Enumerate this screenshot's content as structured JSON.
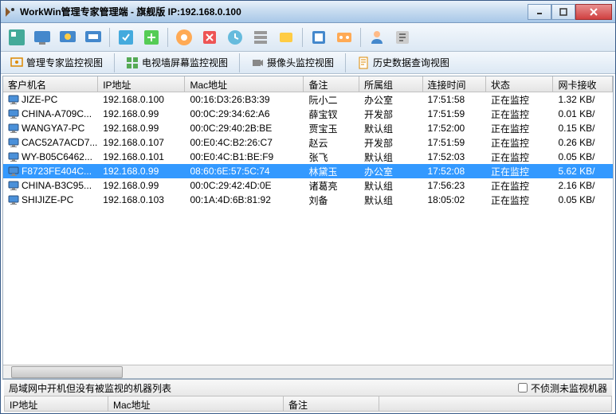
{
  "window": {
    "title": "WorkWin管理专家管理端 - 旗舰版 IP:192.168.0.100"
  },
  "tabs": {
    "expert": "管理专家监控视图",
    "tvwall": "电视墙屏幕监控视图",
    "camera": "摄像头监控视图",
    "history": "历史数据查询视图"
  },
  "table": {
    "headers": [
      "客户机名",
      "IP地址",
      "Mac地址",
      "备注",
      "所属组",
      "连接时间",
      "状态",
      "网卡接收"
    ],
    "rows": [
      {
        "name": "JIZE-PC",
        "ip": "192.168.0.100",
        "mac": "00:16:D3:26:B3:39",
        "note": "阮小二",
        "group": "办公室",
        "time": "17:51:58",
        "status": "正在监控",
        "net": "1.32 KB/",
        "selected": false
      },
      {
        "name": "CHINA-A709C...",
        "ip": "192.168.0.99",
        "mac": "00:0C:29:34:62:A6",
        "note": "薛宝钗",
        "group": "开发部",
        "time": "17:51:59",
        "status": "正在监控",
        "net": "0.01 KB/",
        "selected": false
      },
      {
        "name": "WANGYA7-PC",
        "ip": "192.168.0.99",
        "mac": "00:0C:29:40:2B:BE",
        "note": "贾宝玉",
        "group": "默认组",
        "time": "17:52:00",
        "status": "正在监控",
        "net": "0.15 KB/",
        "selected": false
      },
      {
        "name": "CAC52A7ACD7...",
        "ip": "192.168.0.107",
        "mac": "00:E0:4C:B2:26:C7",
        "note": "赵云",
        "group": "开发部",
        "time": "17:51:59",
        "status": "正在监控",
        "net": "0.26 KB/",
        "selected": false
      },
      {
        "name": "WY-B05C6462...",
        "ip": "192.168.0.101",
        "mac": "00:E0:4C:B1:BE:F9",
        "note": "张飞",
        "group": "默认组",
        "time": "17:52:03",
        "status": "正在监控",
        "net": "0.05 KB/",
        "selected": false
      },
      {
        "name": "F8723FE404C...",
        "ip": "192.168.0.99",
        "mac": "08:60:6E:57:5C:74",
        "note": "林黛玉",
        "group": "办公室",
        "time": "17:52:08",
        "status": "正在监控",
        "net": "5.62 KB/",
        "selected": true
      },
      {
        "name": "CHINA-B3C95...",
        "ip": "192.168.0.99",
        "mac": "00:0C:29:42:4D:0E",
        "note": "诸葛亮",
        "group": "默认组",
        "time": "17:56:23",
        "status": "正在监控",
        "net": "2.16 KB/",
        "selected": false
      },
      {
        "name": "SHIJIZE-PC",
        "ip": "192.168.0.103",
        "mac": "00:1A:4D:6B:81:92",
        "note": "刘备",
        "group": "默认组",
        "time": "18:05:02",
        "status": "正在监控",
        "net": "0.05 KB/",
        "selected": false
      }
    ]
  },
  "bottom": {
    "label": "局域网中开机但没有被监视的机器列表",
    "checkbox": "不侦测未监视机器",
    "headers": [
      "IP地址",
      "Mac地址",
      "备注"
    ]
  }
}
